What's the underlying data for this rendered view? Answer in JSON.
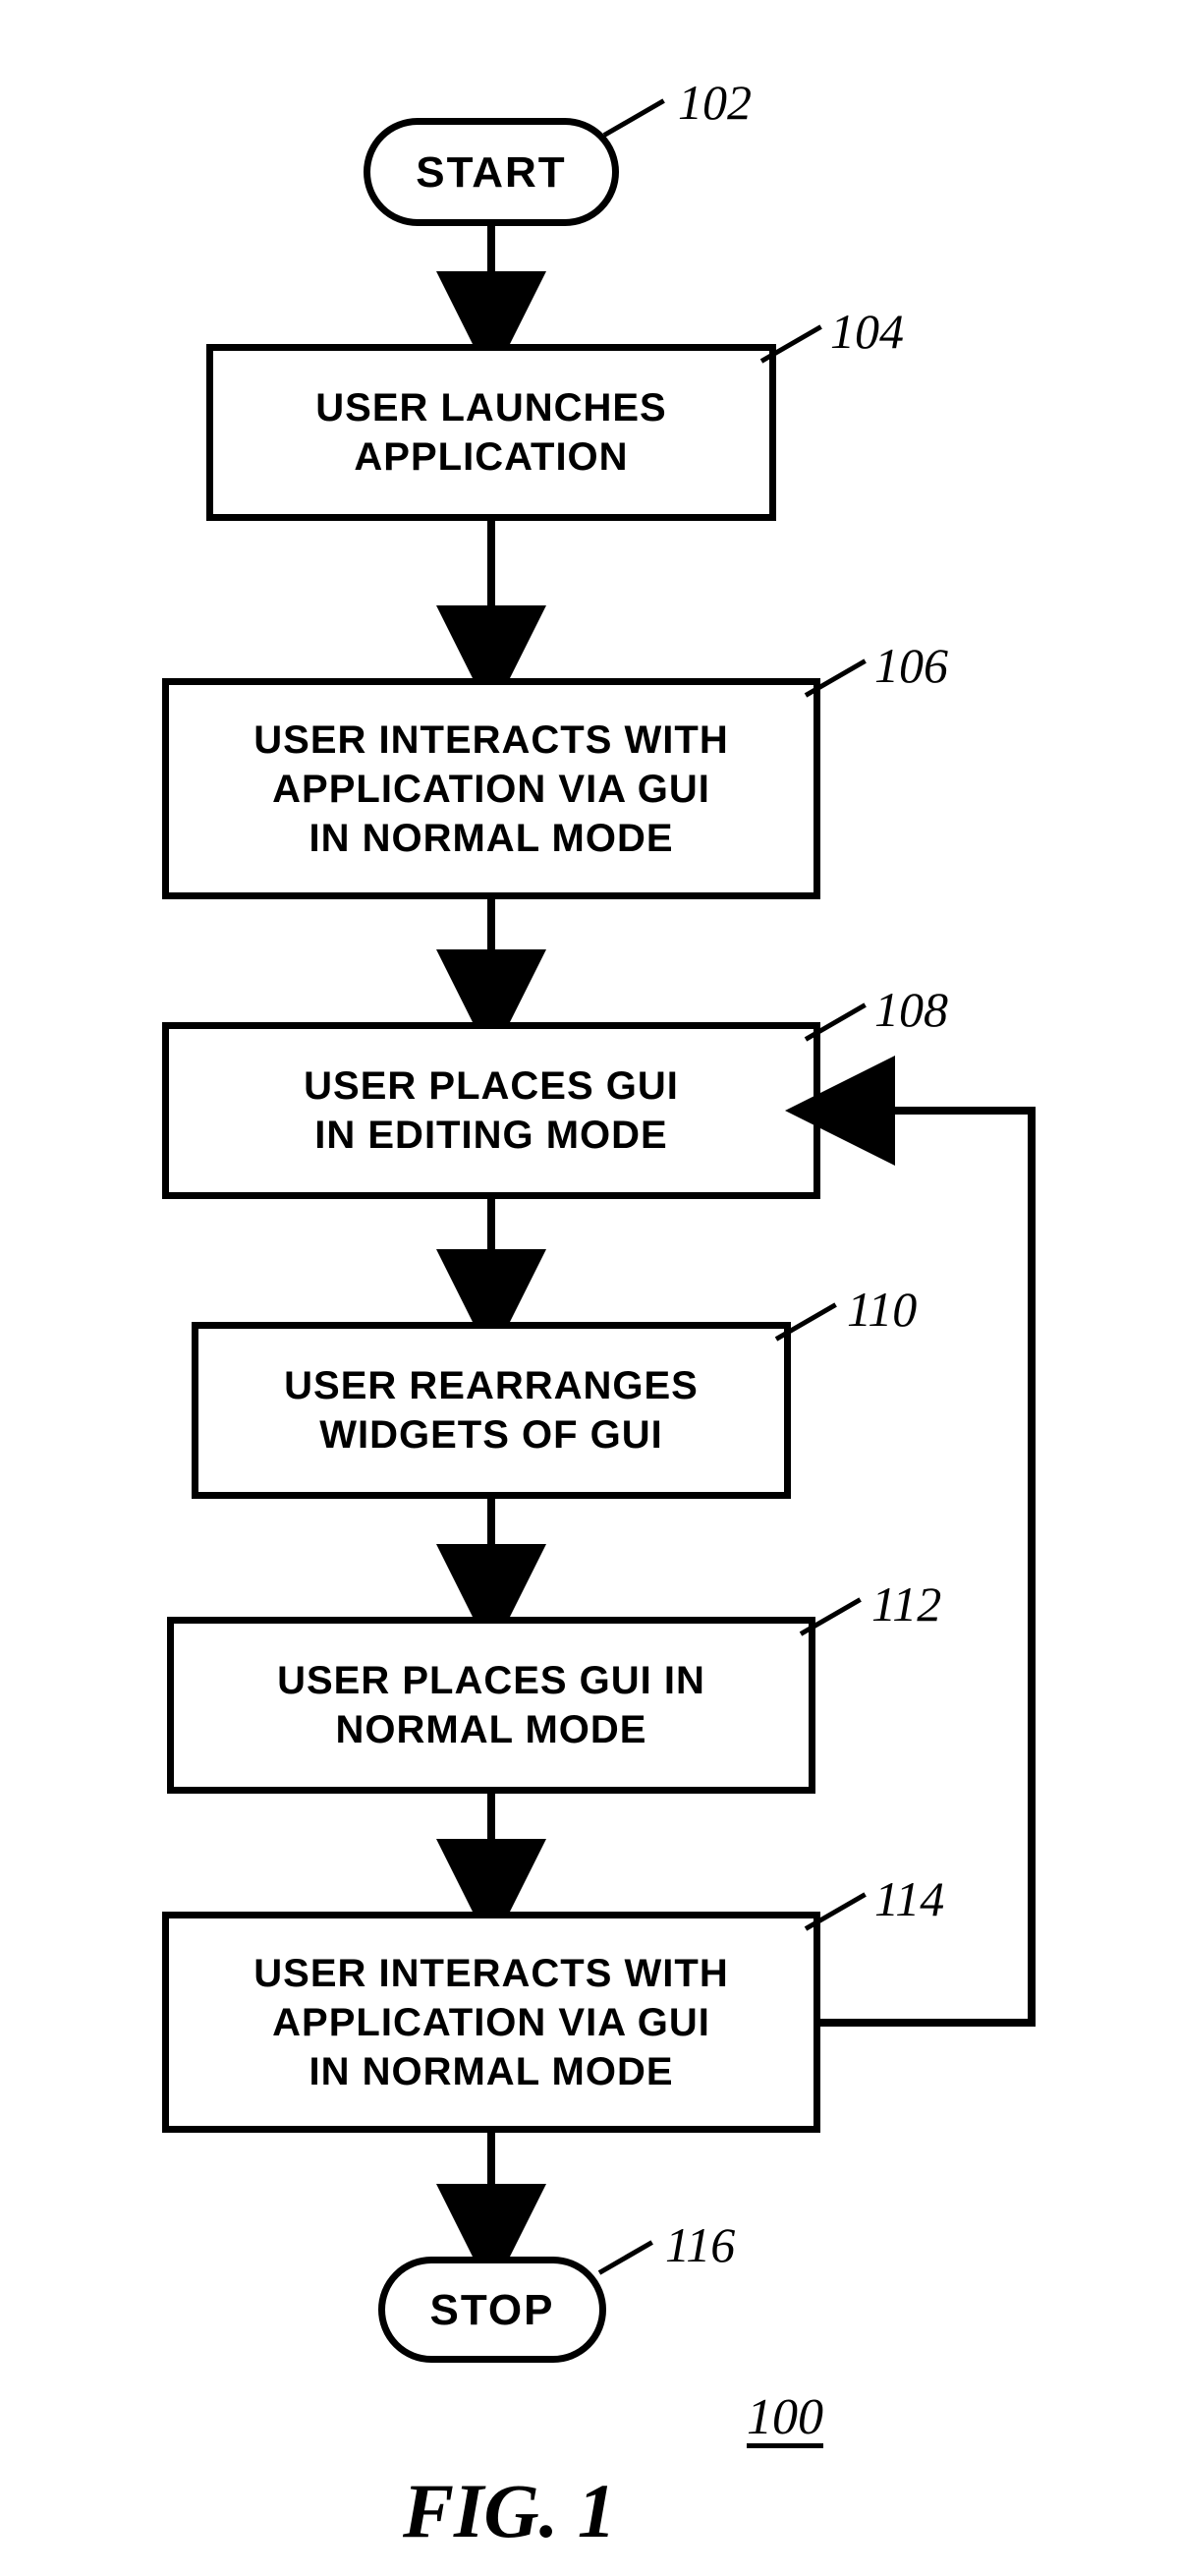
{
  "diagram": {
    "figure_number": "100",
    "figure_title": "FIG. 1",
    "nodes": {
      "start": {
        "label": "START",
        "ref": "102"
      },
      "step1": {
        "label": "USER LAUNCHES\nAPPLICATION",
        "ref": "104"
      },
      "step2": {
        "label": "USER INTERACTS WITH\nAPPLICATION VIA GUI\nIN NORMAL MODE",
        "ref": "106"
      },
      "step3": {
        "label": "USER PLACES GUI\nIN EDITING MODE",
        "ref": "108"
      },
      "step4": {
        "label": "USER REARRANGES\nWIDGETS OF GUI",
        "ref": "110"
      },
      "step5": {
        "label": "USER PLACES GUI IN\nNORMAL MODE",
        "ref": "112"
      },
      "step6": {
        "label": "USER INTERACTS WITH\nAPPLICATION VIA GUI\nIN NORMAL MODE",
        "ref": "114"
      },
      "stop": {
        "label": "STOP",
        "ref": "116"
      }
    }
  }
}
